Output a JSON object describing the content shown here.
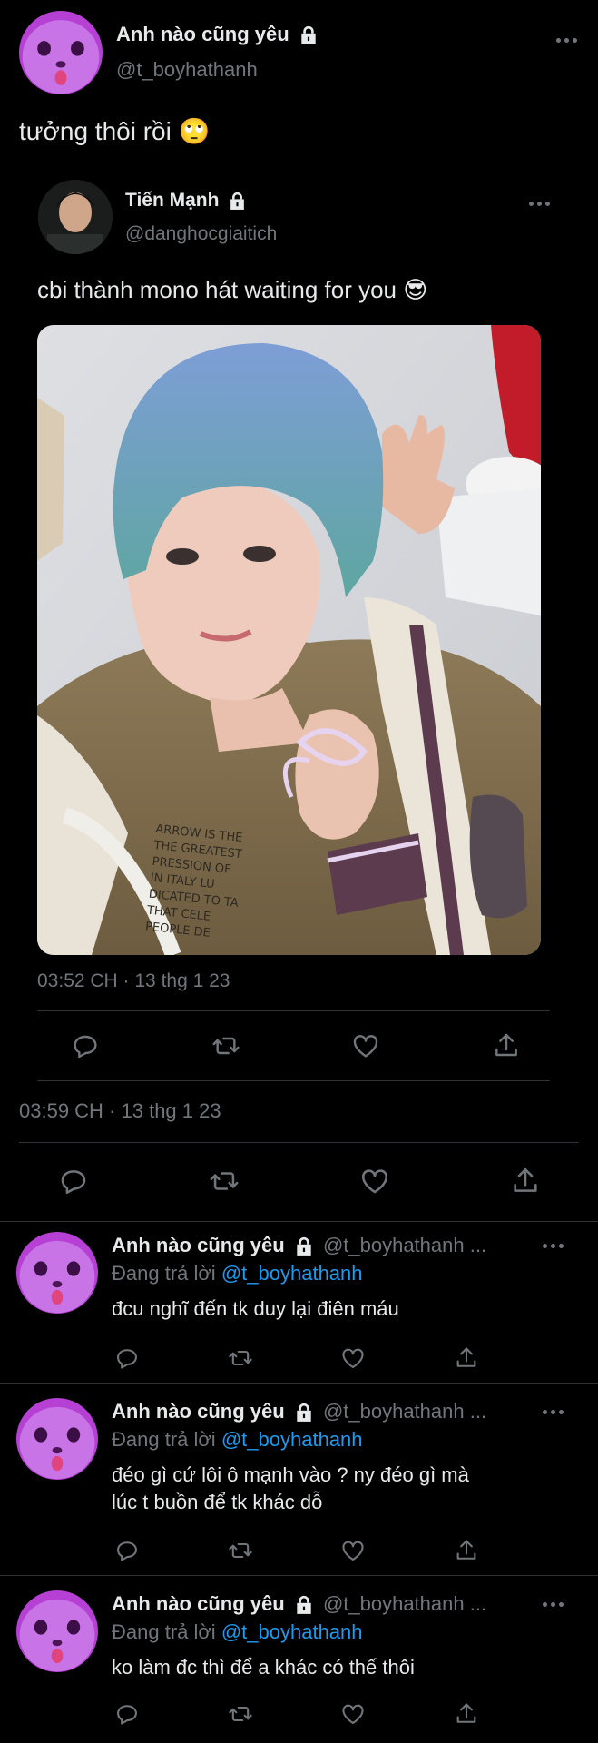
{
  "main_tweet": {
    "display_name": "Anh nào cũng yêu",
    "handle": "@t_boyhathanh",
    "text": "tưởng thôi rồi 🙄",
    "timestamp": "03:59 CH · 13 thg 1 23"
  },
  "quoted_tweet": {
    "display_name": "Tiến Mạnh",
    "handle": "@danghocgiaitich",
    "text": "cbi thành mono hát waiting for you 😎",
    "timestamp": "03:52 CH · 13 thg 1 23",
    "photo_text": "ARROW IS THE THE GREATEST PRESSION OF IN ITALY LU DICATED TO TA THAT CELE PEOPLE DE"
  },
  "replies": [
    {
      "display_name": "Anh nào cũng yêu",
      "handle": "@t_boyhathanh ...",
      "replying_prefix": "Đang trả lời",
      "replying_to": "@t_boyhathanh",
      "text_lines": [
        "đcu nghĩ đến tk duy lại điên máu"
      ]
    },
    {
      "display_name": "Anh nào cũng yêu",
      "handle": "@t_boyhathanh ...",
      "replying_prefix": "Đang trả lời",
      "replying_to": "@t_boyhathanh",
      "text_lines": [
        "đéo gì cứ lôi ô mạnh vào ? ny đéo gì mà",
        "lúc t buồn để tk khác dỗ"
      ]
    },
    {
      "display_name": "Anh nào cũng yêu",
      "handle": "@t_boyhathanh ...",
      "replying_prefix": "Đang trả lời",
      "replying_to": "@t_boyhathanh",
      "text_lines": [
        "ko làm đc thì để a khác có thế thôi"
      ]
    }
  ],
  "icons": [
    "reply-icon",
    "retweet-icon",
    "like-icon",
    "share-icon",
    "lock-icon",
    "more-icon"
  ],
  "colors": {
    "background": "#000000",
    "text": "#e7e9ea",
    "secondary": "#71767b",
    "link": "#1d9bf0",
    "divider": "#2f3336"
  }
}
